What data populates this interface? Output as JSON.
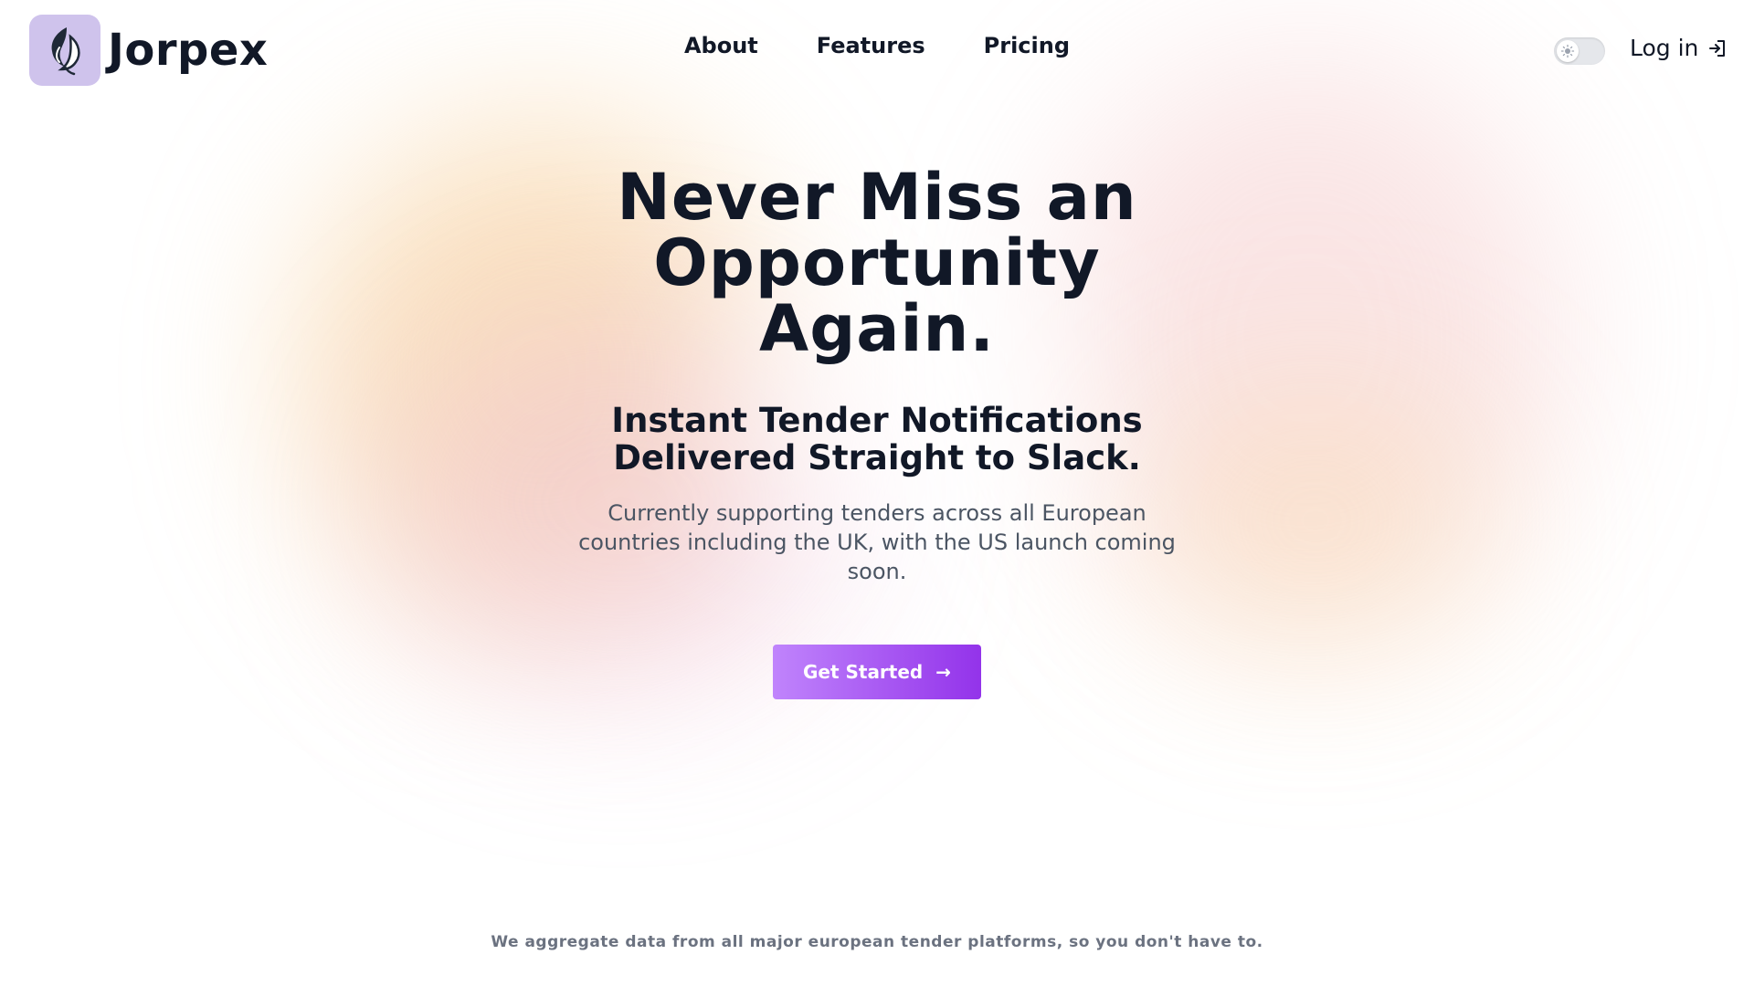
{
  "header": {
    "brand_name": "Jorpex",
    "logo_icon": "flame-leaf-icon",
    "nav": [
      {
        "label": "About"
      },
      {
        "label": "Features"
      },
      {
        "label": "Pricing"
      }
    ],
    "theme_toggle": {
      "state": "light",
      "icon": "sun-icon"
    },
    "login_label": "Log in",
    "login_icon": "login-icon"
  },
  "hero": {
    "headline": "Never Miss an Opportunity Again.",
    "subhead": "Instant Tender Notifications Delivered Straight to Slack.",
    "description": "Currently supporting tenders across all European countries including the UK, with the US launch coming soon.",
    "cta_label": "Get Started",
    "cta_icon": "→"
  },
  "footer_note": "We aggregate data from all major european tender platforms, so you don't have to.",
  "colors": {
    "text": "#111827",
    "muted": "#4b5563",
    "accent_start": "#c084fc",
    "accent_end": "#9333ea",
    "logo_bg": "#cfc3ec"
  }
}
